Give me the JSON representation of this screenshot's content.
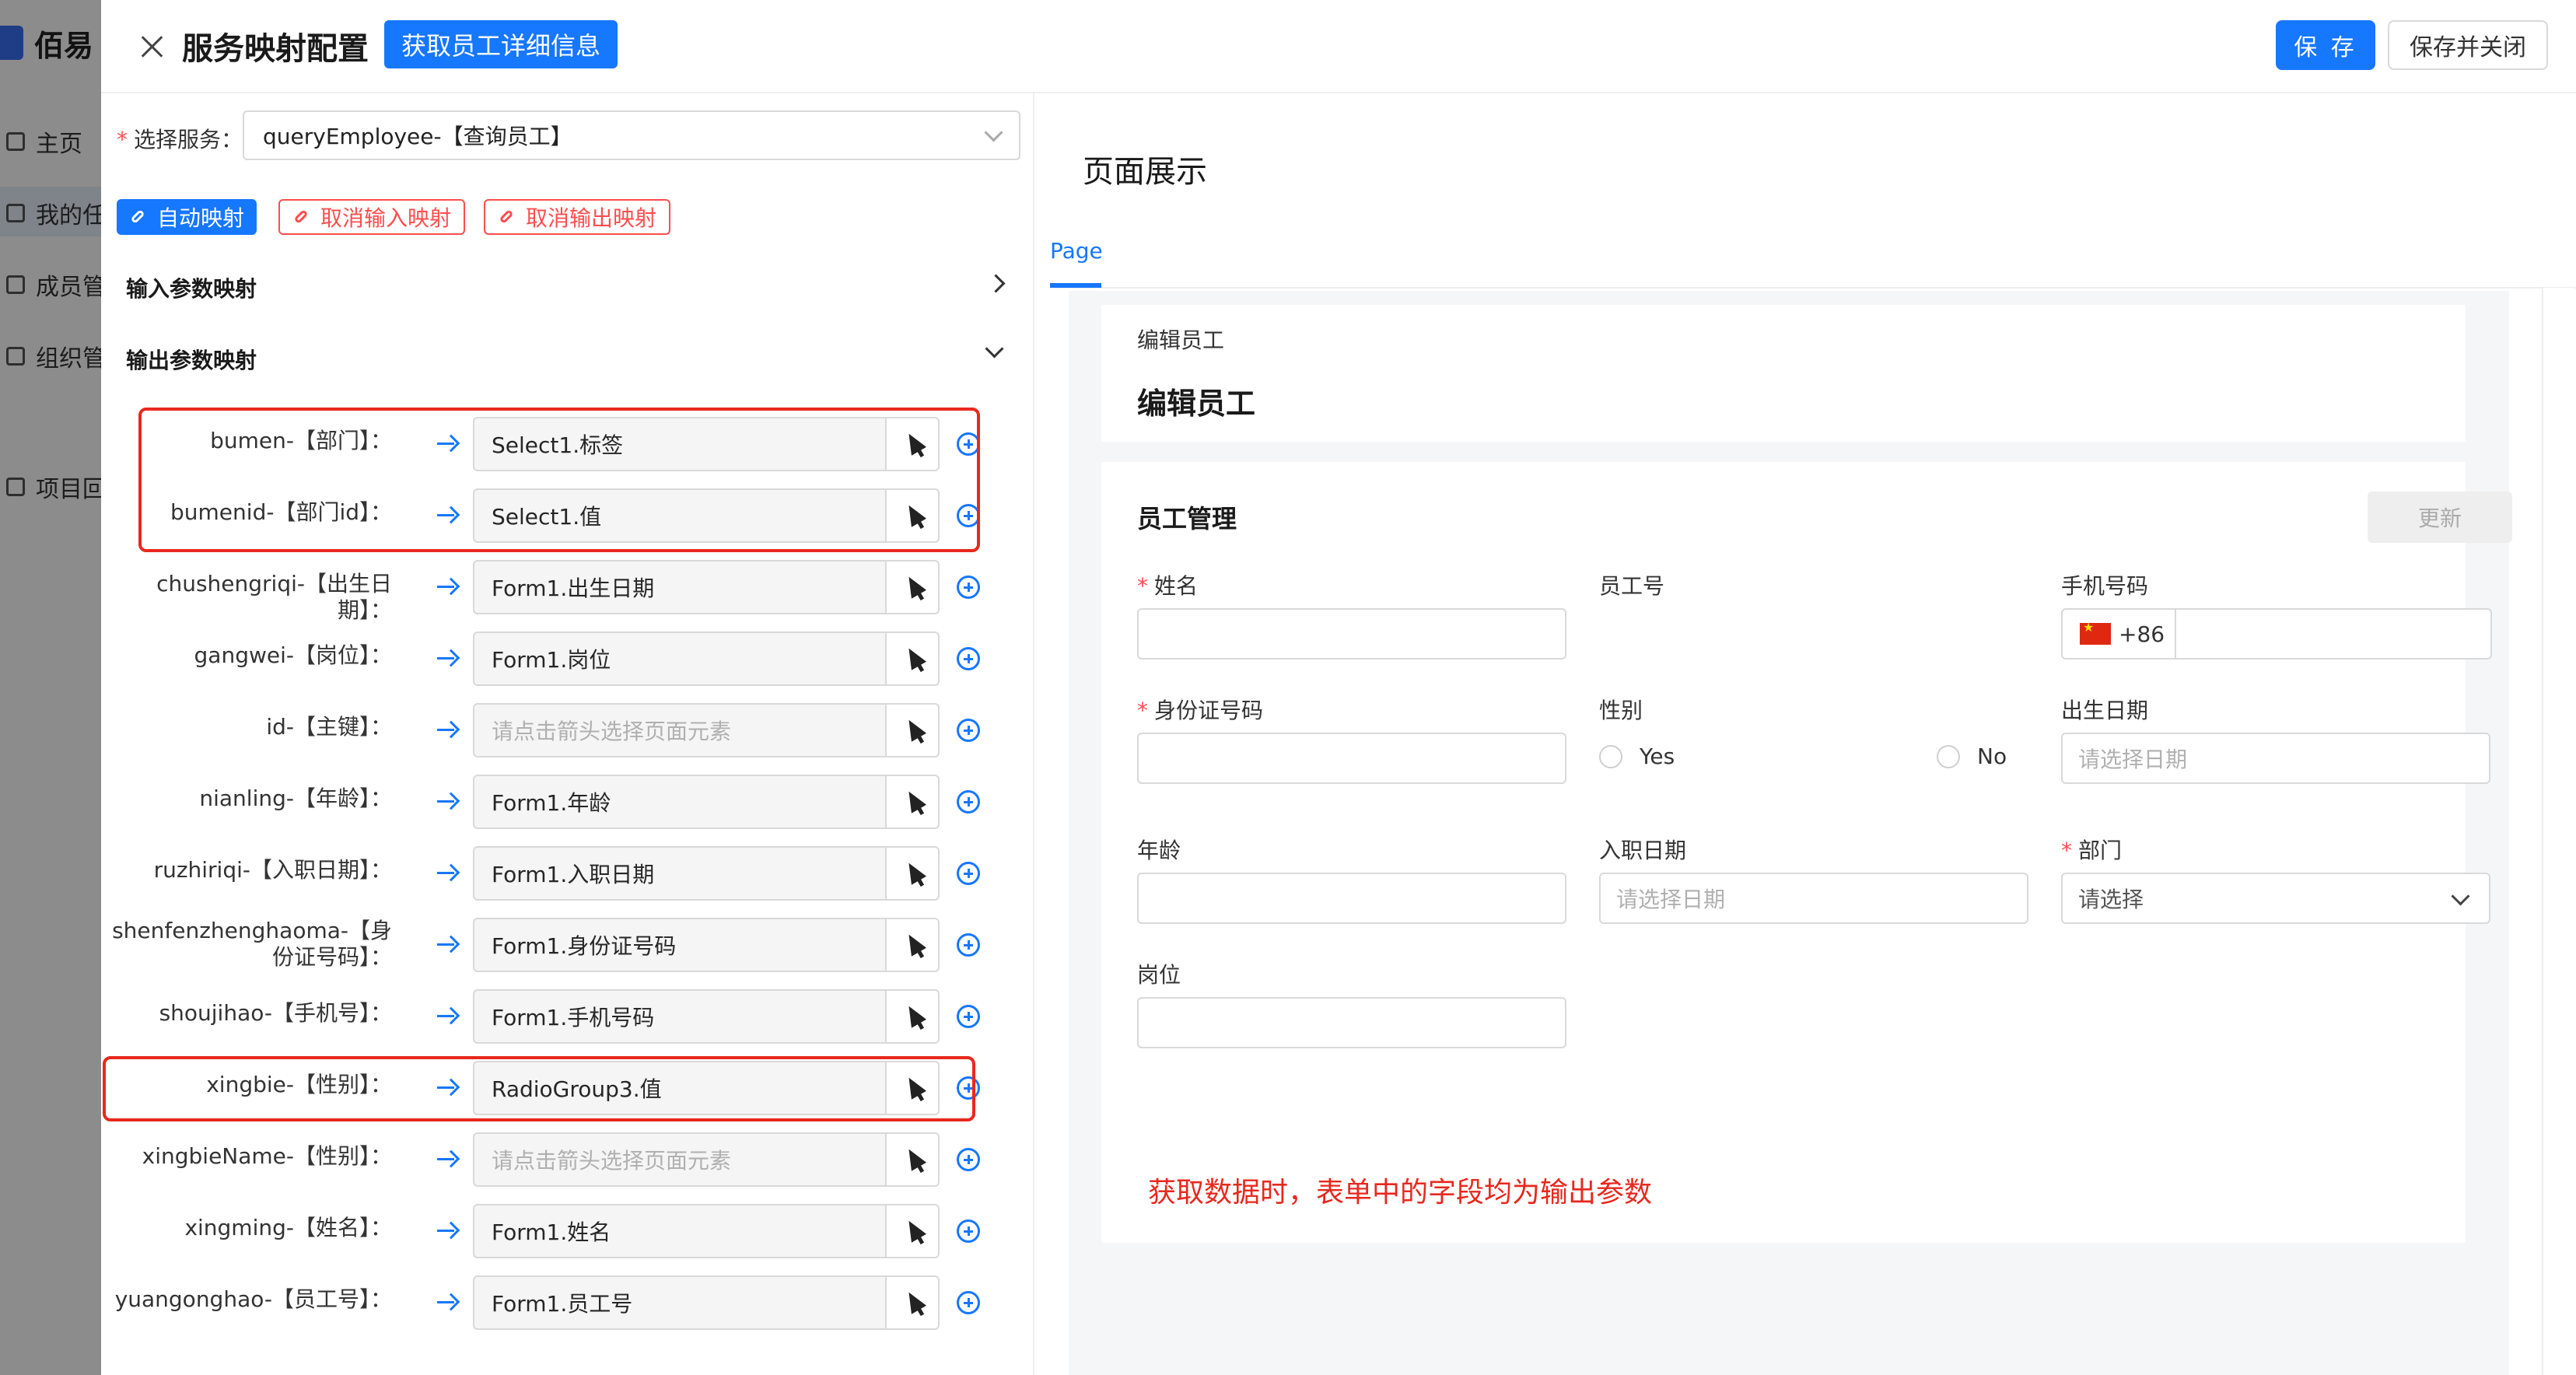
{
  "background_app": {
    "logo_text": "佰易",
    "nav": [
      "主页",
      "我的任",
      "成员管",
      "组织管",
      "项目回"
    ]
  },
  "header": {
    "title": "服务映射配置",
    "fetch_button": "获取员工详细信息",
    "save_button": "保 存",
    "save_close_button": "保存并关闭"
  },
  "left": {
    "service_label": "选择服务：",
    "service_value": "queryEmployee-【查询员工】",
    "auto_map_button": "自动映射",
    "cancel_input_button": "取消输入映射",
    "cancel_output_button": "取消输出映射",
    "input_section": "输入参数映射",
    "output_section": "输出参数映射",
    "mappings": [
      {
        "label": "bumen-【部门】：",
        "value": "Select1.标签",
        "placeholder": false
      },
      {
        "label": "bumenid-【部门id】：",
        "value": "Select1.值",
        "placeholder": false
      },
      {
        "label": "chushengriqi-【出生日期】：",
        "value": "Form1.出生日期",
        "placeholder": false
      },
      {
        "label": "gangwei-【岗位】：",
        "value": "Form1.岗位",
        "placeholder": false
      },
      {
        "label": "id-【主键】：",
        "value": "请点击箭头选择页面元素",
        "placeholder": true
      },
      {
        "label": "nianling-【年龄】：",
        "value": "Form1.年龄",
        "placeholder": false
      },
      {
        "label": "ruzhiriqi-【入职日期】：",
        "value": "Form1.入职日期",
        "placeholder": false
      },
      {
        "label": "shenfenzhenghaoma-【身份证号码】：",
        "value": "Form1.身份证号码",
        "placeholder": false
      },
      {
        "label": "shoujihao-【手机号】：",
        "value": "Form1.手机号码",
        "placeholder": false
      },
      {
        "label": "xingbie-【性别】：",
        "value": "RadioGroup3.值",
        "placeholder": false
      },
      {
        "label": "xingbieName-【性别】：",
        "value": "请点击箭头选择页面元素",
        "placeholder": true
      },
      {
        "label": "xingming-【姓名】：",
        "value": "Form1.姓名",
        "placeholder": false
      },
      {
        "label": "yuangonghao-【员工号】：",
        "value": "Form1.员工号",
        "placeholder": false
      }
    ]
  },
  "preview": {
    "title": "页面展示",
    "tab": "Page",
    "breadcrumb": "编辑员工",
    "heading": "编辑员工",
    "form_title": "员工管理",
    "update_button": "更新",
    "fields": {
      "name": "姓名",
      "employee_no": "员工号",
      "phone": "手机号码",
      "phone_prefix": "+86",
      "id_no": "身份证号码",
      "gender": "性别",
      "gender_yes": "Yes",
      "gender_no": "No",
      "birth_date": "出生日期",
      "birth_date_ph": "请选择日期",
      "age": "年龄",
      "hire_date": "入职日期",
      "hire_date_ph": "请选择日期",
      "department": "部门",
      "department_ph": "请选择",
      "position": "岗位"
    },
    "note": "获取数据时，表单中的字段均为输出参数"
  },
  "colors": {
    "primary": "#1677ff",
    "danger": "#ff4d4f",
    "highlight": "#e8281e"
  }
}
